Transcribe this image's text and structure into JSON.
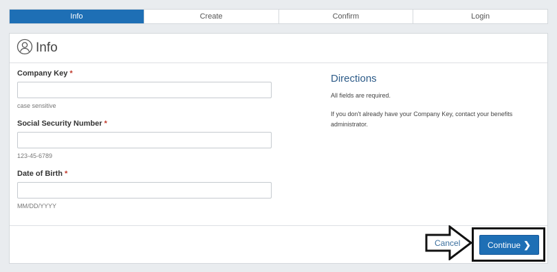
{
  "steps": [
    {
      "label": "Info",
      "active": true
    },
    {
      "label": "Create",
      "active": false
    },
    {
      "label": "Confirm",
      "active": false
    },
    {
      "label": "Login",
      "active": false
    }
  ],
  "panel": {
    "title": "Info",
    "icon": "user-circle-icon"
  },
  "form": {
    "company_key": {
      "label": "Company Key",
      "required_mark": "*",
      "value": "",
      "hint": "case sensitive"
    },
    "ssn": {
      "label": "Social Security Number",
      "required_mark": "*",
      "value": "",
      "hint": "123-45-6789"
    },
    "dob": {
      "label": "Date of Birth",
      "required_mark": "*",
      "value": "",
      "hint": "MM/DD/YYYY"
    }
  },
  "directions": {
    "title": "Directions",
    "line1": "All fields are required.",
    "line2": "If you don't already have your Company Key, contact your benefits administrator."
  },
  "footer": {
    "cancel_label": "Cancel",
    "continue_label": "Continue",
    "continue_chevron": "❯"
  },
  "colors": {
    "accent": "#1e6fb5",
    "background": "#e9ecef",
    "required": "#c0392b",
    "directions_title": "#2d5b88"
  }
}
